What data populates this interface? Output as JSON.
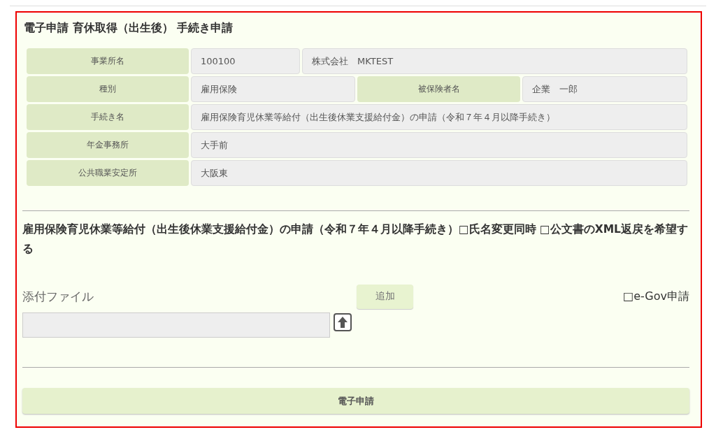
{
  "title": "電子申請  育休取得（出生後）  手続き申請",
  "info_rows": [
    {
      "cells": [
        {
          "kind": "label",
          "text": "事業所名"
        },
        {
          "kind": "value",
          "text": "100100"
        },
        {
          "kind": "value",
          "text": "株式会社　MKTEST"
        }
      ]
    },
    {
      "cells": [
        {
          "kind": "label",
          "text": "種別"
        },
        {
          "kind": "value",
          "text": "雇用保険"
        },
        {
          "kind": "label",
          "text": "被保険者名"
        },
        {
          "kind": "value",
          "text": "企業　一郎"
        }
      ]
    },
    {
      "cells": [
        {
          "kind": "label",
          "text": "手続き名"
        },
        {
          "kind": "value",
          "text": "雇用保険育児休業等給付（出生後休業支援給付金）の申請（令和７年４月以降手続き）"
        }
      ]
    },
    {
      "cells": [
        {
          "kind": "label",
          "text": "年金事務所"
        },
        {
          "kind": "value",
          "text": "大手前"
        }
      ]
    },
    {
      "cells": [
        {
          "kind": "label",
          "text": "公共職業安定所"
        },
        {
          "kind": "value",
          "text": "大阪東"
        }
      ]
    }
  ],
  "procedure_heading": "雇用保険育児休業等給付（出生後休業支援給付金）の申請（令和７年４月以降手続き）□氏名変更同時 □公文書のXML返戻を希望する",
  "attachment": {
    "label": "添付ファイル",
    "add_button": "追加",
    "egov_option": "□e-Gov申請"
  },
  "submit_button": "電子申請"
}
